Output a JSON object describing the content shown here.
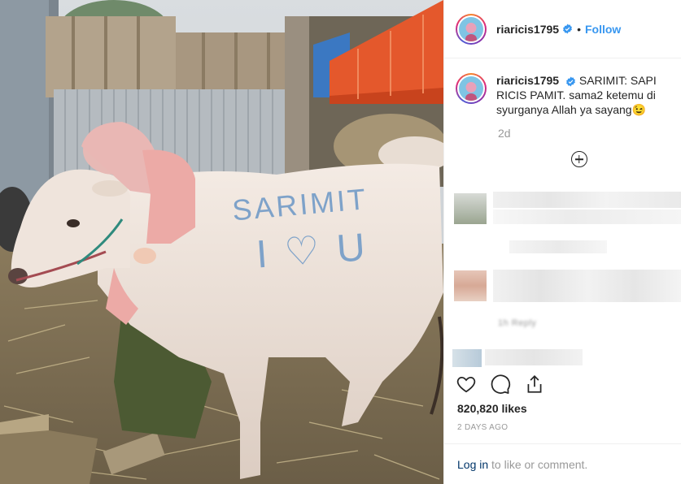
{
  "post": {
    "username": "riaricis1795",
    "follow_label": "Follow",
    "separator": "•",
    "caption": "SARIMIT: SAPI RICIS PAMIT. sama2 ketemu di syurganya Allah ya sayang😉",
    "time_ago_short": "2d",
    "likes": "820,820 likes",
    "date": "2 DAYS AGO",
    "login_link": "Log in",
    "login_suffix": " to like or comment.",
    "reply_label": "1h   Reply"
  },
  "photo": {
    "cow_text_line1": "SARIMIT",
    "cow_text_line2": "I ♡ U"
  },
  "icons": [
    "verified-badge-icon",
    "add-comment-plus-icon",
    "heart-icon",
    "comment-icon",
    "share-icon"
  ],
  "colors": {
    "link": "#3897f0",
    "verified": "#3897f0",
    "muted": "#999999",
    "text": "#262626"
  }
}
